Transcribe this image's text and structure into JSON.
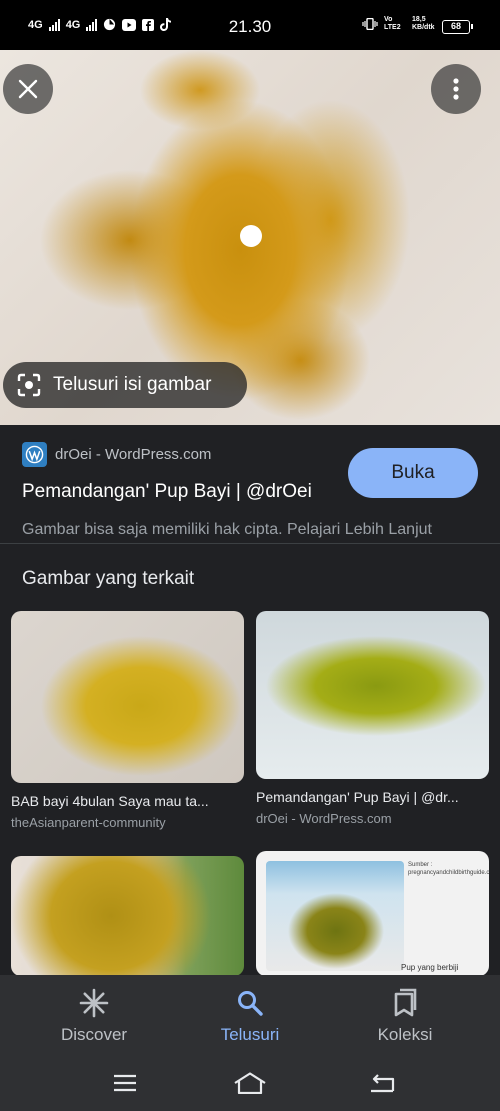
{
  "status_bar": {
    "network1": "4G",
    "network2": "4G",
    "time": "21.30",
    "volte": "Vo LTE2",
    "speed": "18,5 KB/dtk",
    "battery": "68"
  },
  "viewer": {
    "lens_label": "Telusuri isi gambar"
  },
  "source": {
    "site": "drOei - WordPress.com",
    "title": "Pemandangan' Pup Bayi | @drOei",
    "open_button": "Buka",
    "copyright": "Gambar bisa saja memiliki hak cipta. Pelajari Lebih Lanjut"
  },
  "related": {
    "heading": "Gambar yang terkait",
    "items": [
      {
        "title": "BAB bayi 4bulan Saya mau ta...",
        "source": "theAsianparent-community"
      },
      {
        "title": "Pemandangan' Pup Bayi | @dr...",
        "source": "drOei - WordPress.com"
      },
      {
        "title": "",
        "source": ""
      },
      {
        "title": "",
        "source": "",
        "overlay_text": "Sumber : pregnancyandchildbirthguide.com",
        "overlay_caption": "Pup yang berbiji"
      }
    ]
  },
  "bottom_nav": {
    "items": [
      {
        "label": "Discover",
        "icon": "asterisk-icon"
      },
      {
        "label": "Telusuri",
        "icon": "search-icon",
        "active": true
      },
      {
        "label": "Koleksi",
        "icon": "collections-icon"
      }
    ]
  },
  "colors": {
    "accent": "#8ab4f8",
    "background": "#202124",
    "nav_background": "#2f3033"
  }
}
